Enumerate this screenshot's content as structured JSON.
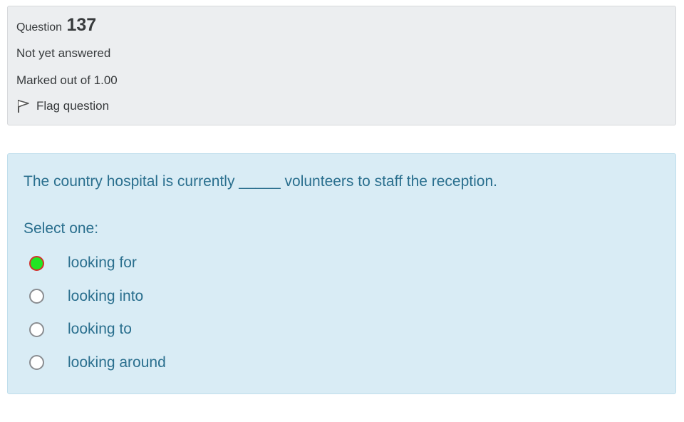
{
  "info": {
    "question_prefix": "Question",
    "question_number": "137",
    "state": "Not yet answered",
    "grade": "Marked out of 1.00",
    "flag_label": "Flag question"
  },
  "formulation": {
    "question_text": "The country hospital is currently _____ volunteers to staff the reception.",
    "prompt": "Select one:",
    "options": [
      {
        "label": "looking for",
        "selected": true
      },
      {
        "label": "looking into",
        "selected": false
      },
      {
        "label": "looking to",
        "selected": false
      },
      {
        "label": "looking around",
        "selected": false
      }
    ]
  },
  "colors": {
    "info_bg": "#eceef0",
    "formulation_bg": "#d9ecf5",
    "formulation_text": "#2a6f8e",
    "selected_radio_fill": "#22e622",
    "selected_radio_border": "#d2322d"
  },
  "icons": {
    "flag": "flag-icon"
  }
}
